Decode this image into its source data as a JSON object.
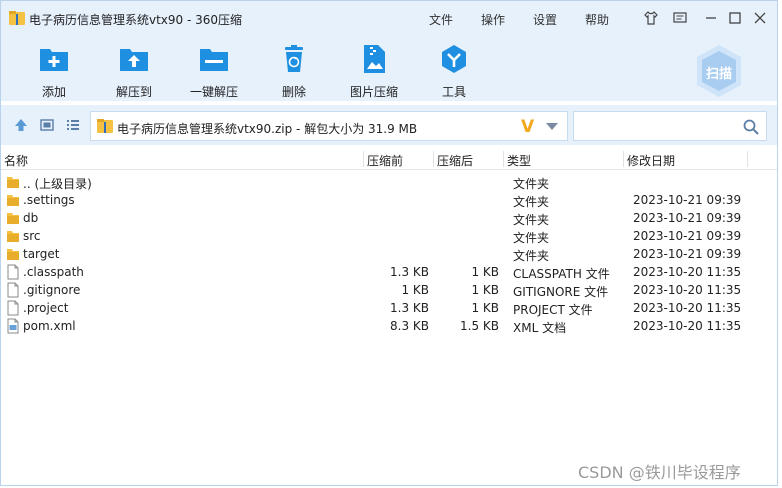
{
  "window": {
    "title": "电子病历信息管理系统vtx90 - 360压缩",
    "menu": [
      "文件",
      "操作",
      "设置",
      "帮助"
    ]
  },
  "toolbar": {
    "buttons": [
      {
        "label": "添加",
        "icon": "add-icon"
      },
      {
        "label": "解压到",
        "icon": "extract-to-icon"
      },
      {
        "label": "一键解压",
        "icon": "one-click-extract-icon"
      },
      {
        "label": "删除",
        "icon": "delete-icon"
      },
      {
        "label": "图片压缩",
        "icon": "image-compress-icon"
      },
      {
        "label": "工具",
        "icon": "tools-icon"
      }
    ],
    "scan_label": "扫描"
  },
  "address": {
    "path": "电子病历信息管理系统vtx90.zip - 解包大小为 31.9 MB",
    "v_badge": "V",
    "search_placeholder": ""
  },
  "columns": {
    "name": "名称",
    "original_size": "压缩前",
    "compressed_size": "压缩后",
    "type": "类型",
    "modified": "修改日期"
  },
  "rows": [
    {
      "name": ".. (上级目录)",
      "original": "",
      "compressed": "",
      "type": "文件夹",
      "date": "",
      "kind": "folder"
    },
    {
      "name": ".settings",
      "original": "",
      "compressed": "",
      "type": "文件夹",
      "date": "2023-10-21 09:39",
      "kind": "folder"
    },
    {
      "name": "db",
      "original": "",
      "compressed": "",
      "type": "文件夹",
      "date": "2023-10-21 09:39",
      "kind": "folder"
    },
    {
      "name": "src",
      "original": "",
      "compressed": "",
      "type": "文件夹",
      "date": "2023-10-21 09:39",
      "kind": "folder"
    },
    {
      "name": "target",
      "original": "",
      "compressed": "",
      "type": "文件夹",
      "date": "2023-10-21 09:39",
      "kind": "folder"
    },
    {
      "name": ".classpath",
      "original": "1.3 KB",
      "compressed": "1 KB",
      "type": "CLASSPATH 文件",
      "date": "2023-10-20 11:35",
      "kind": "file"
    },
    {
      "name": ".gitignore",
      "original": "1 KB",
      "compressed": "1 KB",
      "type": "GITIGNORE 文件",
      "date": "2023-10-20 11:35",
      "kind": "file"
    },
    {
      "name": ".project",
      "original": "1.3 KB",
      "compressed": "1 KB",
      "type": "PROJECT 文件",
      "date": "2023-10-20 11:35",
      "kind": "file"
    },
    {
      "name": "pom.xml",
      "original": "8.3 KB",
      "compressed": "1.5 KB",
      "type": "XML 文档",
      "date": "2023-10-20 11:35",
      "kind": "xml"
    }
  ],
  "watermark": "CSDN @铁川毕设程序",
  "colors": {
    "chrome_bg": "#e6f1fc",
    "accent_blue": "#1e8fe1",
    "folder_yellow": "#f5c143",
    "v_badge": "#f2a81c"
  }
}
